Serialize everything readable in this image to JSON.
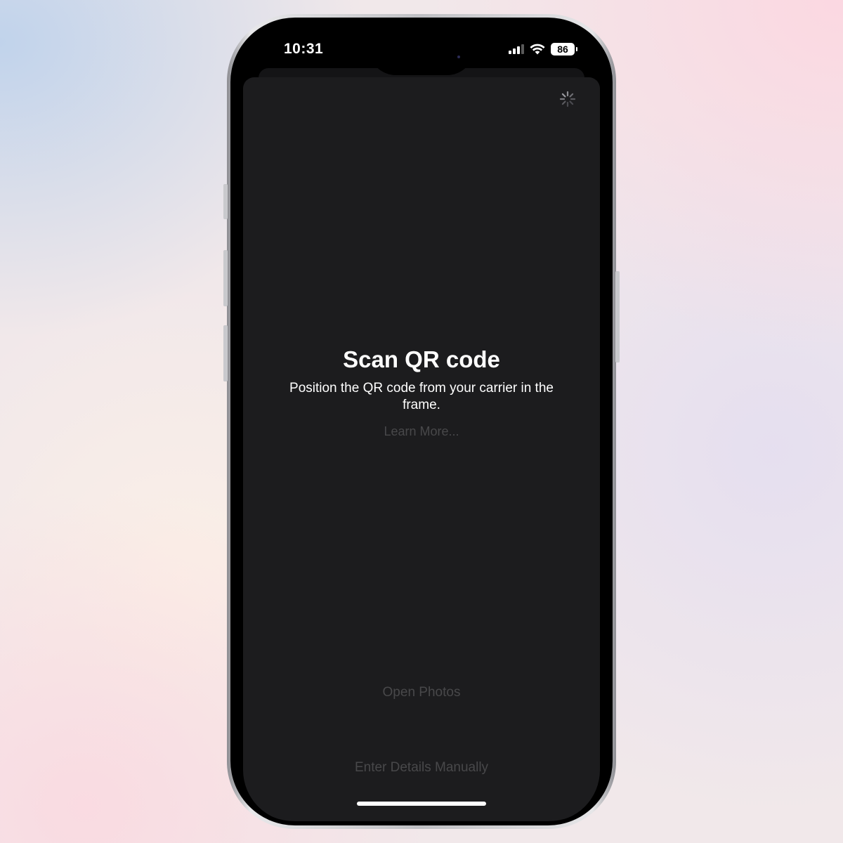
{
  "status_bar": {
    "time": "10:31",
    "battery_level": "86"
  },
  "page": {
    "title": "Scan QR code",
    "subtitle": "Position the QR code from your carrier in the frame.",
    "learn_more": "Learn More...",
    "open_photos": "Open Photos",
    "enter_manually": "Enter Details Manually"
  },
  "icons": {
    "signal": "signal-bars-icon",
    "wifi": "wifi-icon",
    "battery": "battery-icon",
    "loading": "spinner-icon"
  },
  "colors": {
    "sheet_background": "#1c1c1e",
    "text_primary": "#ffffff",
    "text_disabled": "#48484a"
  }
}
